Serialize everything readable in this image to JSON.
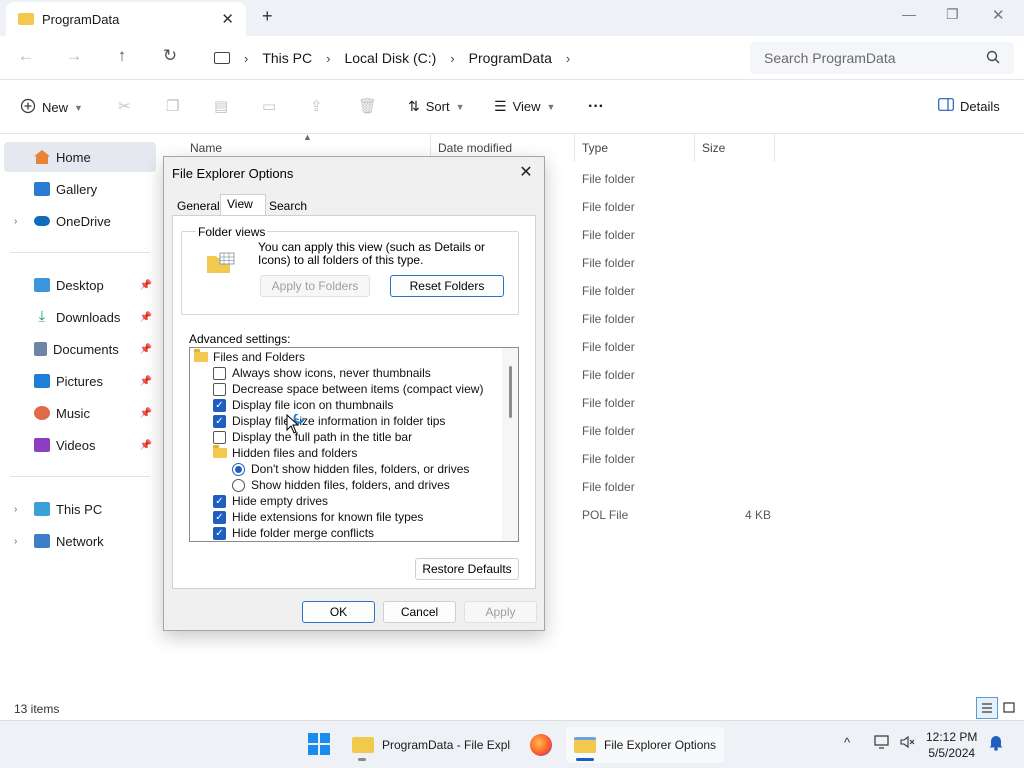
{
  "window": {
    "tab_title": "ProgramData",
    "tab_close": "✕",
    "new_tab": "+",
    "minimize": "—",
    "maximize": "❐",
    "close": "✕"
  },
  "address": {
    "back": "←",
    "forward": "→",
    "up": "↑",
    "refresh": "↻",
    "crumbs": [
      "This PC",
      "Local Disk (C:)",
      "ProgramData"
    ],
    "sep": "›",
    "search_placeholder": "Search ProgramData"
  },
  "commands": {
    "new": "New",
    "sort": "Sort",
    "view": "View",
    "more": "···",
    "details": "Details"
  },
  "sidebar": {
    "items": [
      {
        "label": "Home"
      },
      {
        "label": "Gallery"
      },
      {
        "label": "OneDrive"
      },
      {
        "label": "Desktop"
      },
      {
        "label": "Downloads"
      },
      {
        "label": "Documents"
      },
      {
        "label": "Pictures"
      },
      {
        "label": "Music"
      },
      {
        "label": "Videos"
      },
      {
        "label": "This PC"
      },
      {
        "label": "Network"
      }
    ]
  },
  "filelist": {
    "columns": [
      "Name",
      "Date modified",
      "Type",
      "Size"
    ],
    "rows": [
      {
        "type": "File folder",
        "size": ""
      },
      {
        "type": "File folder",
        "size": ""
      },
      {
        "type": "File folder",
        "size": ""
      },
      {
        "type": "File folder",
        "size": ""
      },
      {
        "type": "File folder",
        "size": ""
      },
      {
        "type": "File folder",
        "size": ""
      },
      {
        "type": "File folder",
        "size": ""
      },
      {
        "type": "File folder",
        "size": ""
      },
      {
        "type": "File folder",
        "size": ""
      },
      {
        "type": "File folder",
        "size": ""
      },
      {
        "type": "File folder",
        "size": ""
      },
      {
        "type": "File folder",
        "size": ""
      },
      {
        "type": "POL File",
        "size": "4 KB"
      }
    ]
  },
  "status": {
    "items_count": "13 items"
  },
  "dialog": {
    "title": "File Explorer Options",
    "close": "✕",
    "tabs": [
      "General",
      "View",
      "Search"
    ],
    "active_tab": "View",
    "folder_views": {
      "legend": "Folder views",
      "description": "You can apply this view (such as Details or Icons) to all folders of this type.",
      "apply_button": "Apply to Folders",
      "reset_button": "Reset Folders"
    },
    "advanced_label": "Advanced settings:",
    "tree": [
      {
        "kind": "folder",
        "label": "Files and Folders",
        "indent": 0
      },
      {
        "kind": "check",
        "checked": false,
        "label": "Always show icons, never thumbnails",
        "indent": 1
      },
      {
        "kind": "check",
        "checked": false,
        "label": "Decrease space between items (compact view)",
        "indent": 1
      },
      {
        "kind": "check",
        "checked": true,
        "label": "Display file icon on thumbnails",
        "indent": 1
      },
      {
        "kind": "check",
        "checked": true,
        "label": "Display file size information in folder tips",
        "indent": 1
      },
      {
        "kind": "check",
        "checked": false,
        "label": "Display the full path in the title bar",
        "indent": 1
      },
      {
        "kind": "folder",
        "label": "Hidden files and folders",
        "indent": 1
      },
      {
        "kind": "radio",
        "checked": true,
        "label": "Don't show hidden files, folders, or drives",
        "indent": 2
      },
      {
        "kind": "radio",
        "checked": false,
        "label": "Show hidden files, folders, and drives",
        "indent": 2
      },
      {
        "kind": "check",
        "checked": true,
        "label": "Hide empty drives",
        "indent": 1
      },
      {
        "kind": "check",
        "checked": true,
        "label": "Hide extensions for known file types",
        "indent": 1
      },
      {
        "kind": "check",
        "checked": true,
        "label": "Hide folder merge conflicts",
        "indent": 1
      }
    ],
    "restore_defaults": "Restore Defaults",
    "ok": "OK",
    "cancel": "Cancel",
    "apply": "Apply"
  },
  "taskbar": {
    "explorer_label": "ProgramData - File Expl",
    "options_label": "File Explorer Options",
    "chevron": "^",
    "time": "12:12 PM",
    "date": "5/5/2024"
  },
  "colors": {
    "accent": "#1f5fbf",
    "folder": "#f2c94c"
  }
}
